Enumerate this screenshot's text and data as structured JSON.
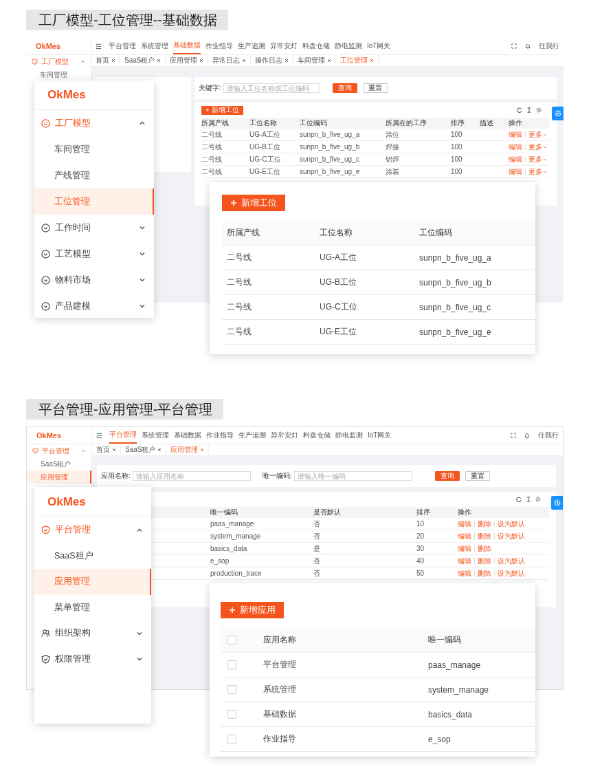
{
  "sections": [
    {
      "heading": "工厂模型-工位管理--基础数据",
      "app": {
        "logo": "OkMes",
        "nav": [
          {
            "label": "平台管理",
            "selected": false
          },
          {
            "label": "系统管理",
            "selected": false
          },
          {
            "label": "基础数据",
            "selected": true
          },
          {
            "label": "作业指导",
            "selected": false
          },
          {
            "label": "生产追溯",
            "selected": false
          },
          {
            "label": "异常安灯",
            "selected": false
          },
          {
            "label": "料盘仓储",
            "selected": false
          },
          {
            "label": "静电监测",
            "selected": false
          },
          {
            "label": "IoT网关",
            "selected": false
          }
        ],
        "user": "任我行",
        "tabs": [
          {
            "label": "首页",
            "selected": false
          },
          {
            "label": "SaaS租户",
            "selected": false
          },
          {
            "label": "应用管理",
            "selected": false
          },
          {
            "label": "异常日志",
            "selected": false
          },
          {
            "label": "操作日志",
            "selected": false
          },
          {
            "label": "车间管理",
            "selected": false
          },
          {
            "label": "工位管理",
            "selected": true
          }
        ],
        "sidebar": [
          {
            "kind": "group",
            "label": "工厂模型",
            "expanded": true
          },
          {
            "kind": "item",
            "label": "车间管理",
            "selected": false
          }
        ],
        "filters": [
          {
            "label": "关键字:",
            "placeholder": "请输入工位名称或工位编码"
          }
        ],
        "buttons": [
          {
            "label": "查询",
            "kind": "primary"
          },
          {
            "label": "重置",
            "kind": "default"
          }
        ],
        "add_button": "新增工位",
        "table": {
          "columns": [
            "所属产线",
            "工位名称",
            "工位编码",
            "所属在的工序",
            "排序",
            "描述",
            "操作"
          ],
          "rows": [
            {
              "cells": [
                "二号线",
                "UG-A工位",
                "sunpn_b_five_ug_a",
                "涂位",
                "100"
              ],
              "actions": [
                {
                  "label": "编辑",
                  "kind": "link"
                },
                {
                  "label": "更多",
                  "kind": "menu"
                }
              ]
            },
            {
              "cells": [
                "二号线",
                "UG-B工位",
                "sunpn_b_five_ug_b",
                "焊接",
                "100"
              ],
              "actions": [
                {
                  "label": "编辑",
                  "kind": "link"
                },
                {
                  "label": "更多",
                  "kind": "menu"
                }
              ]
            },
            {
              "cells": [
                "二号线",
                "UG-C工位",
                "sunpn_b_five_ug_c",
                "铝焊",
                "100"
              ],
              "actions": [
                {
                  "label": "编辑",
                  "kind": "link"
                },
                {
                  "label": "更多",
                  "kind": "menu"
                }
              ]
            },
            {
              "cells": [
                "二号线",
                "UG-E工位",
                "sunpn_b_five_ug_e",
                "涂装",
                "100"
              ],
              "actions": [
                {
                  "label": "编辑",
                  "kind": "link"
                },
                {
                  "label": "更多",
                  "kind": "menu"
                }
              ]
            }
          ]
        }
      },
      "callout_menu": {
        "logo": "OkMes",
        "items": [
          {
            "kind": "group",
            "label": "工厂模型",
            "expanded": true
          },
          {
            "kind": "item",
            "label": "车间管理",
            "selected": false
          },
          {
            "kind": "item",
            "label": "产线管理",
            "selected": false
          },
          {
            "kind": "item",
            "label": "工位管理",
            "selected": true
          },
          {
            "kind": "group",
            "label": "工作时间",
            "expanded": false
          },
          {
            "kind": "group",
            "label": "工艺模型",
            "expanded": false
          },
          {
            "kind": "group",
            "label": "物料市场",
            "expanded": false
          },
          {
            "kind": "group",
            "label": "产品建模",
            "expanded": false
          }
        ]
      },
      "callout_table": {
        "add_button": "新增工位",
        "columns": [
          "所属产线",
          "工位名称",
          "工位编码"
        ],
        "rows": [
          {
            "cells": [
              "二号线",
              "UG-A工位",
              "sunpn_b_five_ug_a"
            ]
          },
          {
            "cells": [
              "二号线",
              "UG-B工位",
              "sunpn_b_five_ug_b"
            ]
          },
          {
            "cells": [
              "二号线",
              "UG-C工位",
              "sunpn_b_five_ug_c"
            ]
          },
          {
            "cells": [
              "二号线",
              "UG-E工位",
              "sunpn_b_five_ug_e"
            ]
          }
        ]
      }
    },
    {
      "heading": "平台管理-应用管理-平台管理",
      "app": {
        "logo": "OkMes",
        "nav": [
          {
            "label": "平台管理",
            "selected": true
          },
          {
            "label": "系统管理",
            "selected": false
          },
          {
            "label": "基础数据",
            "selected": false
          },
          {
            "label": "作业指导",
            "selected": false
          },
          {
            "label": "生产追溯",
            "selected": false
          },
          {
            "label": "异常安灯",
            "selected": false
          },
          {
            "label": "料盘仓储",
            "selected": false
          },
          {
            "label": "静电监测",
            "selected": false
          },
          {
            "label": "IoT网关",
            "selected": false
          }
        ],
        "user": "任我行",
        "tabs": [
          {
            "label": "首页",
            "selected": false
          },
          {
            "label": "SaaS租户",
            "selected": false
          },
          {
            "label": "应用管理",
            "selected": true
          }
        ],
        "sidebar": [
          {
            "kind": "group",
            "label": "平台管理",
            "expanded": true
          },
          {
            "kind": "item",
            "label": "SaaS租户",
            "selected": false
          },
          {
            "kind": "item",
            "label": "应用管理",
            "selected": true
          }
        ],
        "filters": [
          {
            "label": "应用名称:",
            "placeholder": "请输入应用名称"
          },
          {
            "label": "唯一编码:",
            "placeholder": "请输入唯一编码"
          }
        ],
        "buttons": [
          {
            "label": "查询",
            "kind": "primary"
          },
          {
            "label": "重置",
            "kind": "default"
          }
        ],
        "table": {
          "columns": [
            "唯一编码",
            "是否默认",
            "排序",
            "操作"
          ],
          "rows": [
            {
              "cells": [
                "paas_manage",
                "否",
                "10"
              ],
              "actions": [
                {
                  "label": "编辑",
                  "kind": "link"
                },
                {
                  "label": "删除",
                  "kind": "link"
                },
                {
                  "label": "设为默认",
                  "kind": "link"
                }
              ]
            },
            {
              "cells": [
                "system_manage",
                "否",
                "20"
              ],
              "actions": [
                {
                  "label": "编辑",
                  "kind": "link"
                },
                {
                  "label": "删除",
                  "kind": "link"
                },
                {
                  "label": "设为默认",
                  "kind": "link"
                }
              ]
            },
            {
              "cells": [
                "basics_data",
                "是",
                "30"
              ],
              "actions": [
                {
                  "label": "编辑",
                  "kind": "link"
                },
                {
                  "label": "删除",
                  "kind": "link"
                }
              ]
            },
            {
              "cells": [
                "e_sop",
                "否",
                "40"
              ],
              "actions": [
                {
                  "label": "编辑",
                  "kind": "link"
                },
                {
                  "label": "删除",
                  "kind": "link"
                },
                {
                  "label": "设为默认",
                  "kind": "link"
                }
              ]
            },
            {
              "cells": [
                "production_trace",
                "否",
                "50"
              ],
              "actions": [
                {
                  "label": "编辑",
                  "kind": "link"
                },
                {
                  "label": "删除",
                  "kind": "link"
                },
                {
                  "label": "设为默认",
                  "kind": "link"
                }
              ]
            }
          ]
        }
      },
      "callout_menu": {
        "logo": "OkMes",
        "items": [
          {
            "kind": "group",
            "label": "平台管理",
            "expanded": true
          },
          {
            "kind": "item",
            "label": "SaaS租户",
            "selected": false
          },
          {
            "kind": "item",
            "label": "应用管理",
            "selected": true
          },
          {
            "kind": "item",
            "label": "菜单管理",
            "selected": false
          },
          {
            "kind": "group",
            "label": "组织架构",
            "expanded": false
          },
          {
            "kind": "group",
            "label": "权限管理",
            "expanded": false
          }
        ]
      },
      "callout_table": {
        "add_button": "新增应用",
        "header_checked": false,
        "columns": [
          "应用名称",
          "唯一编码"
        ],
        "rows": [
          {
            "checked": false,
            "cells": [
              "平台管理",
              "paas_manage"
            ]
          },
          {
            "checked": false,
            "cells": [
              "系统管理",
              "system_manage"
            ]
          },
          {
            "checked": false,
            "cells": [
              "基础数据",
              "basics_data"
            ]
          },
          {
            "checked": false,
            "cells": [
              "作业指导",
              "e_sop"
            ]
          }
        ]
      }
    }
  ]
}
